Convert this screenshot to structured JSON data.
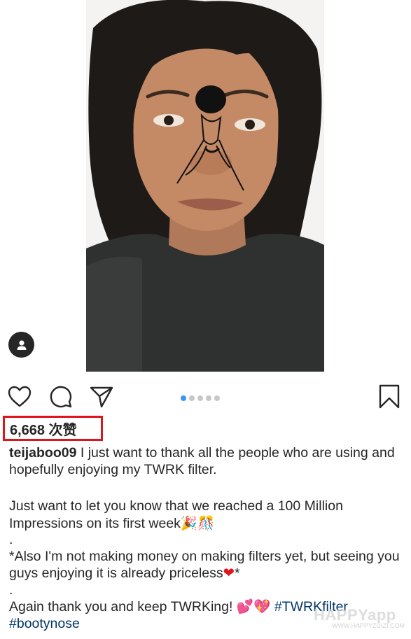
{
  "post": {
    "image_description_icon": "selfie-with-nose-filter-photo",
    "tag_icon": "user-tag-icon",
    "actions": {
      "like_icon": "heart-icon",
      "comment_icon": "comment-bubble-icon",
      "share_icon": "paper-plane-icon",
      "save_icon": "bookmark-icon"
    },
    "carousel": {
      "total": 5,
      "active_index": 0
    },
    "likes_text": "6,668 次赞",
    "likes_highlight_color": "#e0141b",
    "caption": {
      "username": "teijaboo09",
      "line1": " I just want to thank all the people who are using and hopefully enjoying my TWRK filter.",
      "line2": "Just want to let you know that we reached a 100 Million Impressions on its first week",
      "line2_emoji": "🎉🎊",
      "dot1": ".",
      "line3": "*Also I'm  not making money on making filters yet, but seeing you guys enjoying it is already priceless",
      "line3_emoji": "❤",
      "line3_end": "*",
      "dot2": ".",
      "line4": "Again  thank you and keep TWRKing! ",
      "line4_emoji": "💕💖",
      "hashtag1": "#TWRKfilter",
      "hashtag2": "#bootynose"
    },
    "hashtag_color": "#003569"
  },
  "watermark": {
    "text": "HAPPYapp",
    "sub": "WWW.HAPPYZUIZI.COM"
  }
}
